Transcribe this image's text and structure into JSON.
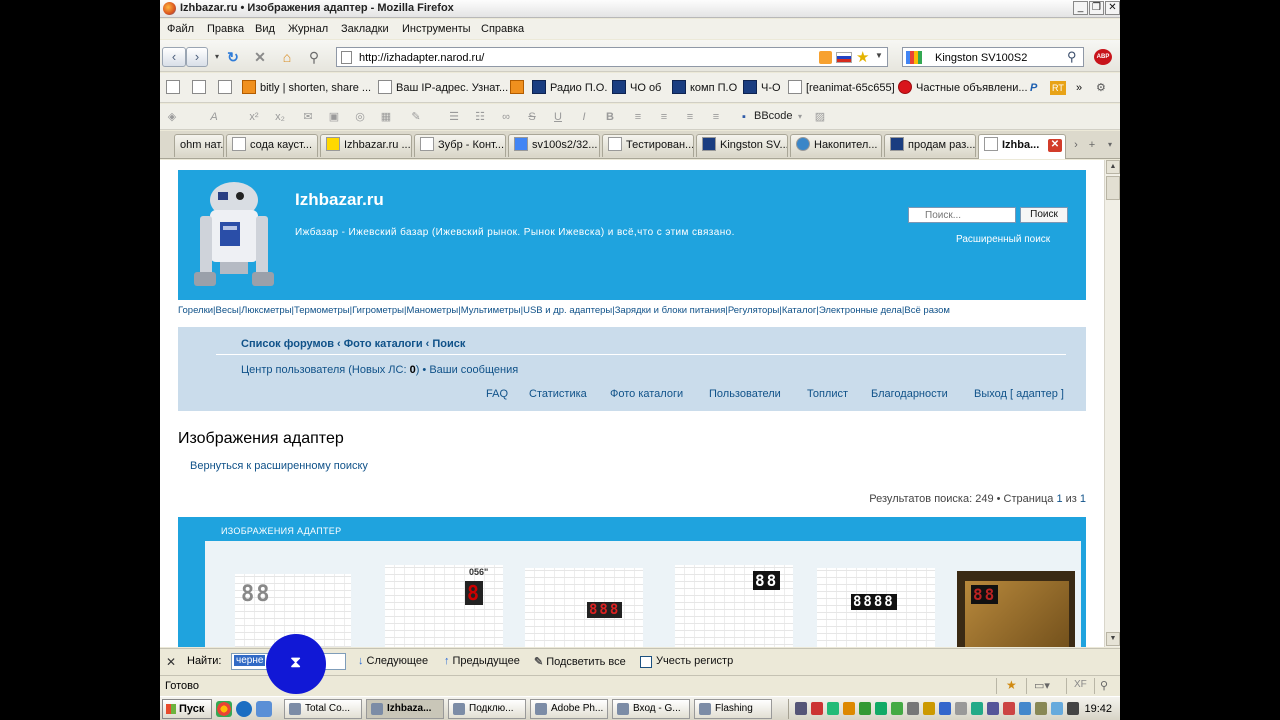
{
  "window": {
    "title": "Izhbazar.ru • Изображения адаптер - Mozilla Firefox",
    "controls": [
      "_",
      "❐",
      "✕"
    ]
  },
  "menu": [
    "Файл",
    "Правка",
    "Вид",
    "Журнал",
    "Закладки",
    "Инструменты",
    "Справка"
  ],
  "nav": {
    "url": "http://izhadapter.narod.ru/",
    "search_value": "Kingston SV100S2"
  },
  "bookmarks": [
    {
      "label": "bitly | shorten, share ...",
      "icon": "smiley-icon",
      "type": ""
    },
    {
      "label": "Ваш IP-адрес. Узнат...",
      "icon": "page-icon",
      "type": ""
    },
    {
      "label": "Радио П.О.",
      "icon": "mail-icon",
      "type": "mail"
    },
    {
      "label": "ЧО  об",
      "icon": "mail-icon",
      "type": "mail"
    },
    {
      "label": "комп П.О",
      "icon": "mail-icon",
      "type": "mail"
    },
    {
      "label": "Ч-О",
      "icon": "mail-icon",
      "type": "mail"
    },
    {
      "label": "[reanimat-65c655]",
      "icon": "page-icon",
      "type": ""
    },
    {
      "label": "Частные объявлени...",
      "icon": "avito-icon",
      "type": "red"
    }
  ],
  "editor": {
    "bbcode_label": "BBcode"
  },
  "tabs": [
    {
      "label": "ohm нат...",
      "active": false
    },
    {
      "label": "сода кауст...",
      "active": false
    },
    {
      "label": "Izhbazar.ru ...",
      "active": false
    },
    {
      "label": "Зубр - Конт...",
      "active": false
    },
    {
      "label": "sv100s2/32...",
      "active": false
    },
    {
      "label": "Тестирован...",
      "active": false
    },
    {
      "label": "Kingston SV...",
      "active": false
    },
    {
      "label": "Накопител...",
      "active": false
    },
    {
      "label": "продам раз...",
      "active": false
    },
    {
      "label": "Izhba...",
      "active": true
    }
  ],
  "site": {
    "title": "Izhbazar.ru",
    "description": "Ижбазар - Ижевский базар (Ижевский рынок. Рынок Ижевска) и всё,что с этим связано.",
    "search_placeholder": "Поиск...",
    "search_button": "Поиск",
    "advanced_search": "Расширенный поиск",
    "categories": "Горелки|Весы|Люксметры|Термометры|Гигрометры|Манометры|Мультиметры|USB и др. адаптеры|Зарядки и блоки питания|Регуляторы|Каталог|Электронные дела|Всё разом"
  },
  "navpanel": {
    "breadcrumbs": "Список форумов ‹ Фото каталоги ‹ Поиск",
    "ucp_prefix": "Центр пользователя (Новых ЛС: ",
    "ucp_count": "0",
    "ucp_suffix": ") • Ваши сообщения",
    "links": [
      "FAQ",
      "Статистика",
      "Фото каталоги",
      "Пользователи",
      "Топлист",
      "Благодарности",
      "Выход [ адаптер ]"
    ]
  },
  "page": {
    "title": "Изображения адаптер",
    "back_link": "Вернуться к расширенному поиску",
    "results_prefix": "Результатов поиска: 249 • Страница ",
    "results_page": "1",
    "results_mid": " из ",
    "results_total": "1",
    "gallery_heading": "ИЗОБРАЖЕНИЯ АДАПТЕР",
    "thumb_labels": [
      "",
      "056\"",
      "",
      "",
      "",
      ""
    ]
  },
  "findbar": {
    "label": "Найти:",
    "value": "черне",
    "next": "Следующее",
    "prev": "Предыдущее",
    "highlight": "Подсветить все",
    "match_case": "Учесть регистр"
  },
  "status": {
    "text": "Готово"
  },
  "taskbar": {
    "start": "Пуск",
    "tasks": [
      {
        "label": "Total Co...",
        "active": false
      },
      {
        "label": "Izhbaza...",
        "active": true
      },
      {
        "label": "Подклю...",
        "active": false
      },
      {
        "label": "Adobe Ph...",
        "active": false
      },
      {
        "label": "Вход - G...",
        "active": false
      },
      {
        "label": "Flashing",
        "active": false
      }
    ],
    "clock": "19:42"
  },
  "colors": {
    "header_blue": "#1fa3de",
    "nav_panel": "#cadceb",
    "link": "#105289"
  }
}
